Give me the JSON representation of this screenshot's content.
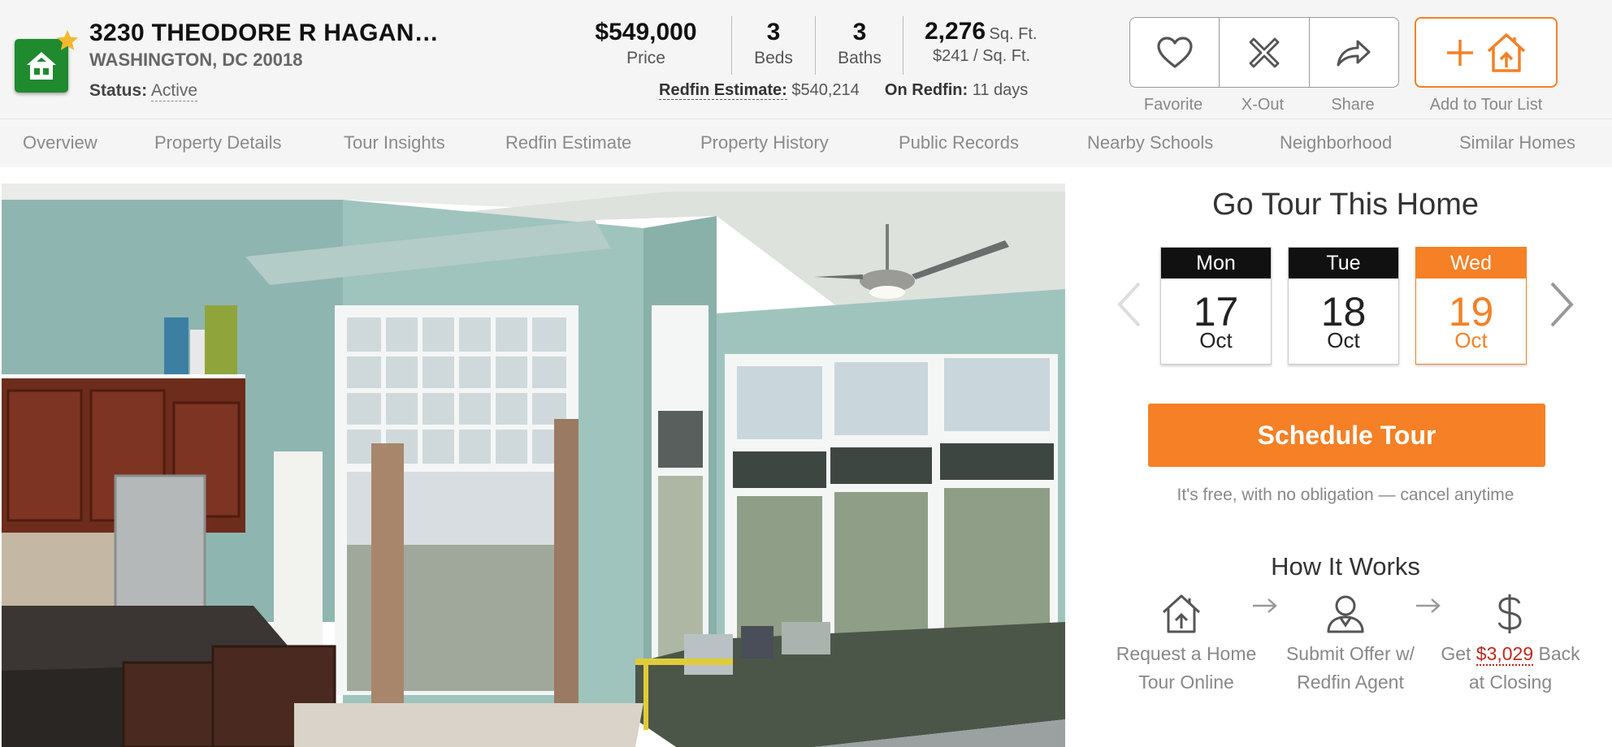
{
  "header": {
    "address": "3230 THEODORE R HAGAN…",
    "city": "WASHINGTON, DC 20018",
    "status_label": "Status:",
    "status_value": "Active",
    "price": "$549,000",
    "price_label": "Price",
    "beds": "3",
    "beds_label": "Beds",
    "baths": "3",
    "baths_label": "Baths",
    "sqft": "2,276",
    "sqft_unit": "Sq. Ft.",
    "price_per_sqft": "$241 / Sq. Ft.",
    "estimate_label": "Redfin Estimate:",
    "estimate_value": "$540,214",
    "on_redfin_label": "On Redfin:",
    "on_redfin_value": "11 days"
  },
  "actions": {
    "favorite": "Favorite",
    "xout": "X-Out",
    "share": "Share",
    "add_tour": "Add to Tour List"
  },
  "tabs": [
    "Overview",
    "Property Details",
    "Tour Insights",
    "Redfin Estimate",
    "Property History",
    "Public Records",
    "Nearby Schools",
    "Neighborhood",
    "Similar Homes"
  ],
  "tour": {
    "title": "Go Tour This Home",
    "days": [
      {
        "name": "Mon",
        "num": "17",
        "month": "Oct"
      },
      {
        "name": "Tue",
        "num": "18",
        "month": "Oct"
      },
      {
        "name": "Wed",
        "num": "19",
        "month": "Oct"
      }
    ],
    "schedule_label": "Schedule Tour",
    "note": "It's free, with no obligation — cancel anytime"
  },
  "how": {
    "title": "How It Works",
    "step1_l1": "Request a Home",
    "step1_l2": "Tour Online",
    "step2_l1": "Submit Offer w/",
    "step2_l2": "Redfin Agent",
    "step3_pre": "Get",
    "step3_amount": "$3,029",
    "step3_post": "Back",
    "step3_l2": "at Closing"
  },
  "colors": {
    "accent": "#f58025",
    "logo_green": "#1f8a2e",
    "money_red": "#c0271c"
  },
  "icons": {
    "logo": "house-icon",
    "favorite": "heart-icon",
    "xout": "x-out-icon",
    "share": "share-arrow-icon",
    "add_tour": "plus-house-icon",
    "prev": "chevron-left-icon",
    "next": "chevron-right-icon",
    "step1": "house-upload-icon",
    "step2": "agent-icon",
    "step3": "dollar-icon"
  }
}
